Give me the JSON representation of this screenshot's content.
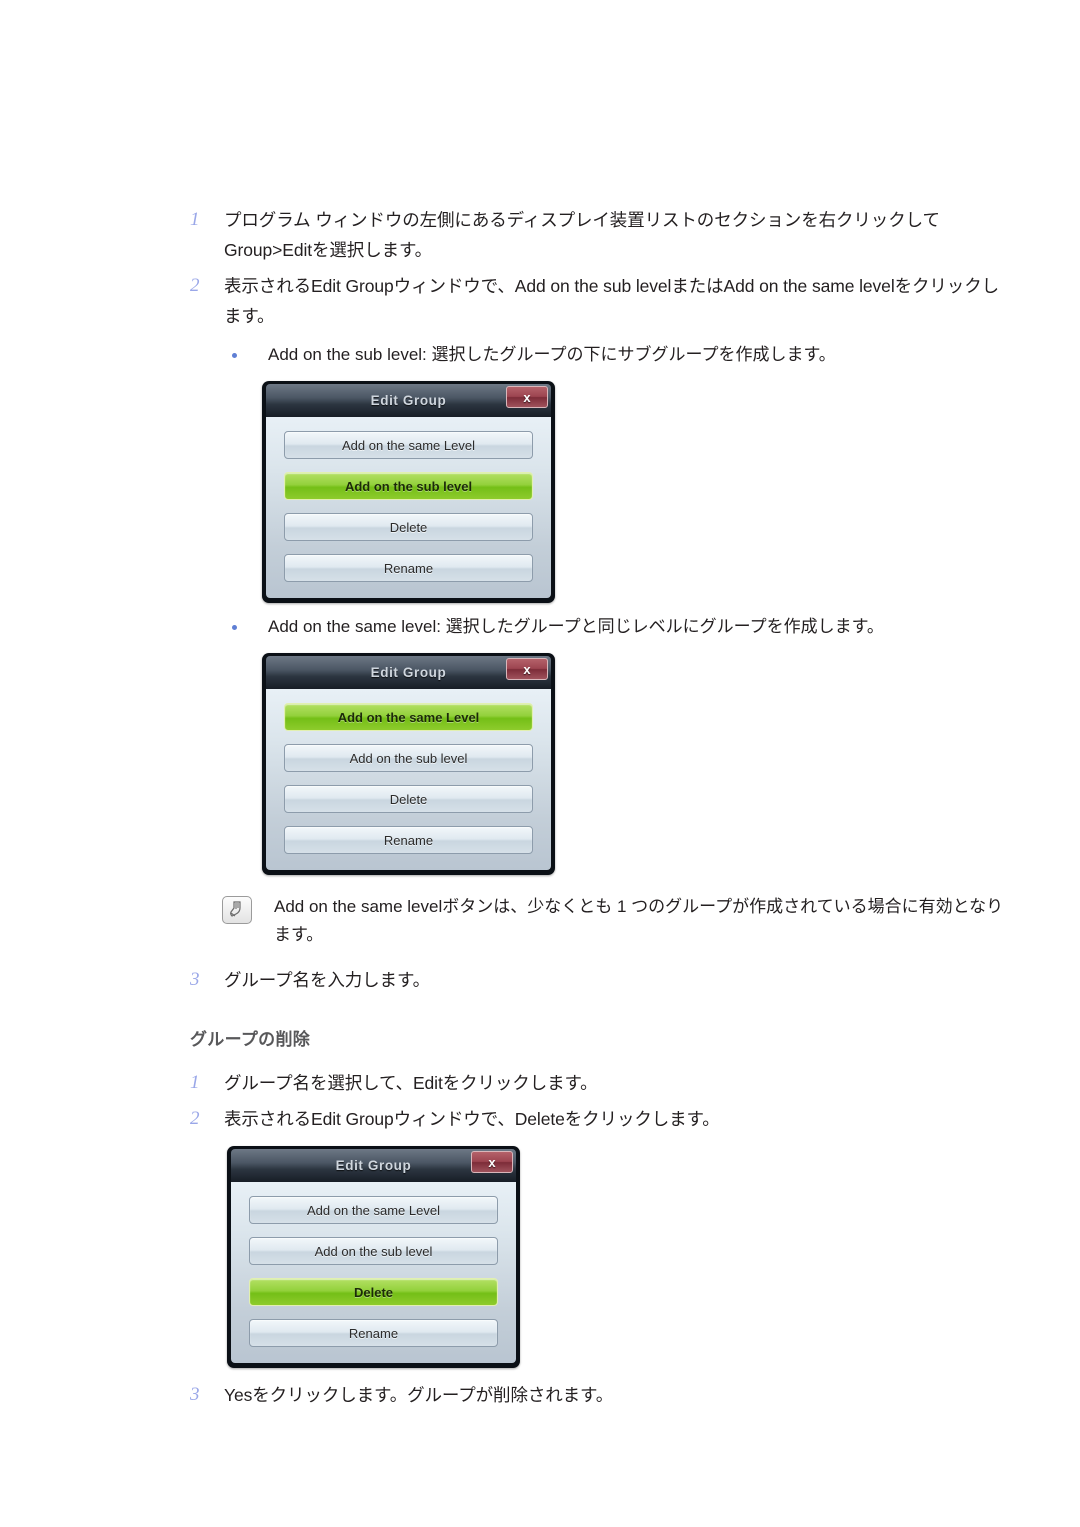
{
  "page": {
    "sections": [
      {
        "type": "step",
        "num": "1",
        "text": "プログラム ウィンドウの左側にあるディスプレイ装置リストのセクションを右クリックして Group>Editを選択します。"
      },
      {
        "type": "step",
        "num": "2",
        "text": "表示されるEdit Groupウィンドウで、Add on the sub levelまたはAdd on the same levelをクリックします。"
      },
      {
        "type": "bullet",
        "text": "Add on the sub level: 選択したグループの下にサブグループを作成します。"
      },
      {
        "type": "bullet",
        "text": "Add on the same level: 選択したグループと同じレベルにグループを作成します。"
      },
      {
        "type": "note",
        "icon": "note-pencil-icon",
        "text": "Add on the same levelボタンは、少なくとも 1 つのグループが作成されている場合に有効となります。"
      },
      {
        "type": "step",
        "num": "3",
        "text": "グループ名を入力します。"
      },
      {
        "type": "heading",
        "text": "グループの削除"
      },
      {
        "type": "step",
        "num": "1",
        "text": "グループ名を選択して、Editをクリックします。"
      },
      {
        "type": "step",
        "num": "2",
        "text": "表示されるEdit Groupウィンドウで、Deleteをクリックします。"
      },
      {
        "type": "step",
        "num": "3",
        "text": "Yesをクリックします。グループが削除されます。"
      }
    ]
  },
  "dialogs": [
    {
      "id": "dialog-sub-level",
      "title": "Edit Group",
      "close_label": "x",
      "buttons": [
        {
          "label": "Add on the same Level",
          "selected": false
        },
        {
          "label": "Add on the sub level",
          "selected": true
        },
        {
          "label": "Delete",
          "selected": false
        },
        {
          "label": "Rename",
          "selected": false
        }
      ]
    },
    {
      "id": "dialog-same-level",
      "title": "Edit Group",
      "close_label": "x",
      "buttons": [
        {
          "label": "Add on the same Level",
          "selected": true
        },
        {
          "label": "Add on the sub level",
          "selected": false
        },
        {
          "label": "Delete",
          "selected": false
        },
        {
          "label": "Rename",
          "selected": false
        }
      ]
    },
    {
      "id": "dialog-delete",
      "title": "Edit Group",
      "close_label": "x",
      "buttons": [
        {
          "label": "Add on the same Level",
          "selected": false
        },
        {
          "label": "Add on the sub level",
          "selected": false
        },
        {
          "label": "Delete",
          "selected": true
        },
        {
          "label": "Rename",
          "selected": false
        }
      ]
    }
  ],
  "colors": {
    "step_number": "#9aa7e8",
    "bullet_dot": "#5f7fd4",
    "heading": "#58585a",
    "selected_button": "#8ecb2c",
    "close_button": "#9c4450",
    "text": "#231f20"
  }
}
